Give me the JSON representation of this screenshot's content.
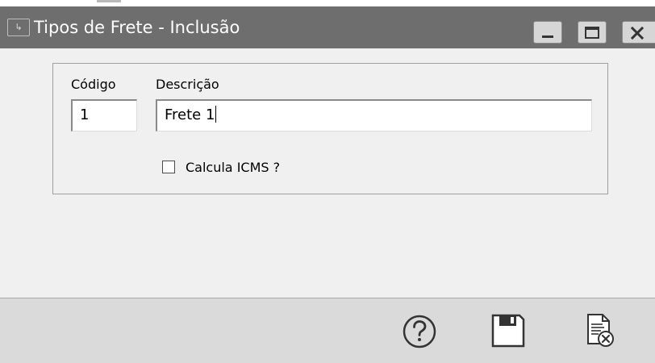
{
  "window": {
    "title": "Tipos de Frete - Inclusão",
    "icon": "app-window-icon"
  },
  "titlebar_buttons": [
    {
      "name": "minimize-icon"
    },
    {
      "name": "maximize-icon"
    },
    {
      "name": "close-icon"
    }
  ],
  "form": {
    "codigo_label": "Código",
    "codigo_value": "1",
    "descricao_label": "Descrição",
    "descricao_value": "Frete 1",
    "icms_label": "Calcula ICMS ?",
    "icms_checked": false
  },
  "footer_buttons": [
    {
      "name": "help-icon"
    },
    {
      "name": "save-icon"
    },
    {
      "name": "cancel-document-icon"
    }
  ],
  "colors": {
    "titlebar": "#6e6e6e",
    "window_bg": "#f0f0f0",
    "footer_bg": "#dadada"
  }
}
